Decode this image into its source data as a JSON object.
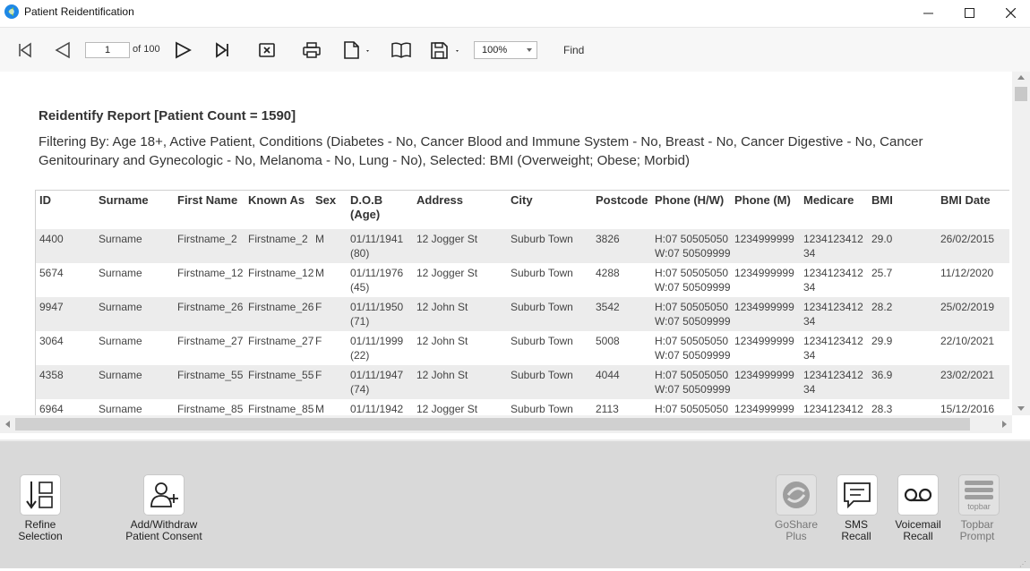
{
  "window": {
    "title": "Patient Reidentification",
    "accent_color": "#1e88e5"
  },
  "toolbar": {
    "page_value": "1",
    "page_of": "of 100",
    "zoom_value": "100%",
    "find_label": "Find",
    "icons": [
      "first-page-icon",
      "prev-page-icon",
      "next-page-icon",
      "last-page-icon",
      "stop-icon",
      "print-icon",
      "page-setup-icon",
      "book-view-icon",
      "save-icon"
    ]
  },
  "report": {
    "title": "Reidentify Report  [Patient Count = 1590]",
    "filter": "Filtering By: Age 18+, Active Patient, Conditions (Diabetes - No, Cancer Blood and Immune System - No, Breast - No, Cancer Digestive - No, Cancer Genitourinary and Gynecologic - No, Melanoma - No, Lung - No), Selected: BMI (Overweight; Obese; Morbid)",
    "columns": [
      "ID",
      "Surname",
      "First Name",
      "Known As",
      "Sex",
      "D.O.B\n(Age)",
      "Address",
      "City",
      "Postcode",
      "Phone (H/W)",
      "Phone (M)",
      "Medicare",
      "BMI",
      "BMI Date"
    ],
    "rows": [
      [
        "4400",
        "Surname",
        "Firstname_2",
        "Firstname_2",
        "M",
        "01/11/1941\n(80)",
        "12 Jogger St",
        "Suburb Town",
        "3826",
        "H:07 50505050\nW:07 50509999",
        "1234999999",
        "1234123412\n34",
        "29.0",
        "26/02/2015"
      ],
      [
        "5674",
        "Surname",
        "Firstname_12",
        "Firstname_12",
        "M",
        "01/11/1976\n(45)",
        "12 Jogger St",
        "Suburb Town",
        "4288",
        "H:07 50505050\nW:07 50509999",
        "1234999999",
        "1234123412\n34",
        "25.7",
        "11/12/2020"
      ],
      [
        "9947",
        "Surname",
        "Firstname_26",
        "Firstname_26",
        "F",
        "01/11/1950\n(71)",
        "12 John St",
        "Suburb Town",
        "3542",
        "H:07 50505050\nW:07 50509999",
        "1234999999",
        "1234123412\n34",
        "28.2",
        "25/02/2019"
      ],
      [
        "3064",
        "Surname",
        "Firstname_27",
        "Firstname_27",
        "F",
        "01/11/1999\n(22)",
        "12 John St",
        "Suburb Town",
        "5008",
        "H:07 50505050\nW:07 50509999",
        "1234999999",
        "1234123412\n34",
        "29.9",
        "22/10/2021"
      ],
      [
        "4358",
        "Surname",
        "Firstname_55",
        "Firstname_55",
        "F",
        "01/11/1947\n(74)",
        "12 John St",
        "Suburb Town",
        "4044",
        "H:07 50505050\nW:07 50509999",
        "1234999999",
        "1234123412\n34",
        "36.9",
        "23/02/2021"
      ],
      [
        "6964",
        "Surname",
        "Firstname_85",
        "Firstname_85",
        "M",
        "01/11/1942",
        "12 Jogger St",
        "Suburb Town",
        "2113",
        "H:07 50505050",
        "1234999999",
        "1234123412",
        "28.3",
        "15/12/2016"
      ]
    ]
  },
  "actions": {
    "refine": "Refine\nSelection",
    "consent": "Add/Withdraw\nPatient Consent",
    "goshare": "GoShare\nPlus",
    "sms": "SMS\nRecall",
    "voicemail": "Voicemail\nRecall",
    "topbar": "Topbar\nPrompt",
    "topbar_logo_text": "topbar"
  }
}
